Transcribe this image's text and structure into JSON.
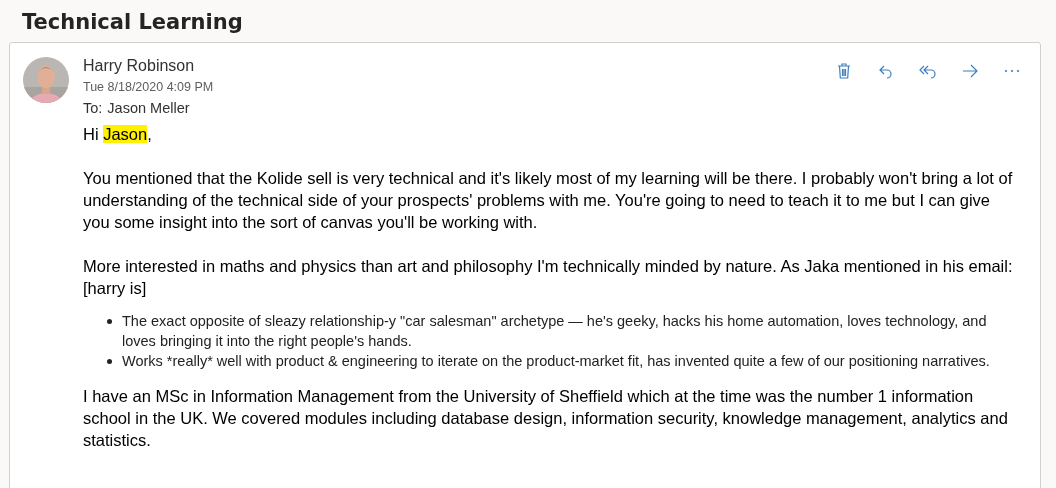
{
  "folder_title": "Technical Learning",
  "message": {
    "sender": "Harry Robinson",
    "date": "Tue 8/18/2020 4:09 PM",
    "to_label": "To:",
    "to": "Jason Meller",
    "actions": [
      {
        "kind": "delete"
      },
      {
        "kind": "reply"
      },
      {
        "kind": "reply_all"
      },
      {
        "kind": "forward"
      },
      {
        "kind": "more"
      }
    ],
    "greeting": {
      "before": "Hi ",
      "highlight": "Jason",
      "after": ","
    },
    "paragraphs_before": [
      "You mentioned that the Kolide sell is very technical and it's likely most of my learning will be there. I probably won't bring a lot of understanding of the technical side of your prospects' problems with me. You're going to need to teach it to me but I can give you some insight into the sort of canvas you'll be working with.",
      "More interested in maths and physics than art and philosophy I'm technically minded by nature. As Jaka mentioned in his email: [harry is]"
    ],
    "bullets": [
      "The exact opposite of sleazy relationship-y \"car salesman\" archetype — he's geeky, hacks his home automation, loves technology, and loves bringing it into the right people's hands.",
      "Works *really* well with product & engineering to iterate on the product-market fit, has invented quite a few of our positioning narratives."
    ],
    "paragraphs_after": [
      "I have an MSc in Information Management from the University of Sheffield which at the time was the number 1 information school in the UK. We covered modules including database design, information security, knowledge management, analytics and statistics."
    ]
  }
}
